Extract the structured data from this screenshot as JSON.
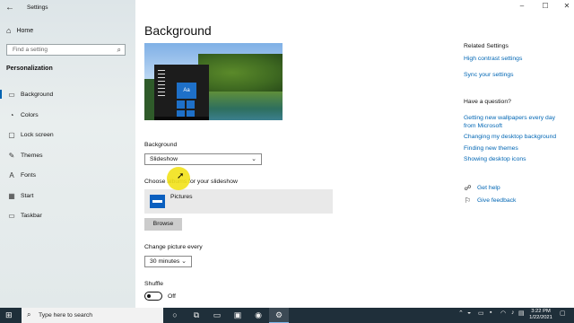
{
  "window": {
    "title": "Settings",
    "back_icon": "back-arrow-icon",
    "controls": [
      "minimize-icon",
      "maximize-icon",
      "close-icon"
    ]
  },
  "sidebar": {
    "home_label": "Home",
    "search_placeholder": "Find a setting",
    "section_title": "Personalization",
    "items": [
      {
        "label": "Background",
        "icon": "picture-icon",
        "active": true
      },
      {
        "label": "Colors",
        "icon": "palette-icon",
        "active": false
      },
      {
        "label": "Lock screen",
        "icon": "lock-screen-icon",
        "active": false
      },
      {
        "label": "Themes",
        "icon": "brush-icon",
        "active": false
      },
      {
        "label": "Fonts",
        "icon": "fonts-icon",
        "active": false
      },
      {
        "label": "Start",
        "icon": "start-menu-icon",
        "active": false
      },
      {
        "label": "Taskbar",
        "icon": "taskbar-icon",
        "active": false
      }
    ]
  },
  "main": {
    "title": "Background",
    "preview_tile_text": "Aa",
    "background_label": "Background",
    "background_value": "Slideshow",
    "albums_label": "Choose albums for your slideshow",
    "album_name": "Pictures",
    "browse_label": "Browse",
    "change_every_label": "Change picture every",
    "change_every_value": "30 minutes",
    "shuffle_label": "Shuffle",
    "shuffle_state": "Off"
  },
  "related": {
    "heading": "Related Settings",
    "links": [
      "High contrast settings",
      "Sync your settings"
    ],
    "question_heading": "Have a question?",
    "help_links": [
      "Getting new wallpapers every day from Microsoft",
      "Changing my desktop background",
      "Finding new themes",
      "Showing desktop icons"
    ],
    "get_help": "Get help",
    "give_feedback": "Give feedback"
  },
  "taskbar": {
    "search_placeholder": "Type here to search",
    "time": "3:22 PM",
    "date": "1/22/2021"
  },
  "colors": {
    "accent": "#0063b1",
    "link": "#0066b4",
    "taskbar": "#1f2f3a",
    "cursor_highlight": "#f2e21a"
  }
}
